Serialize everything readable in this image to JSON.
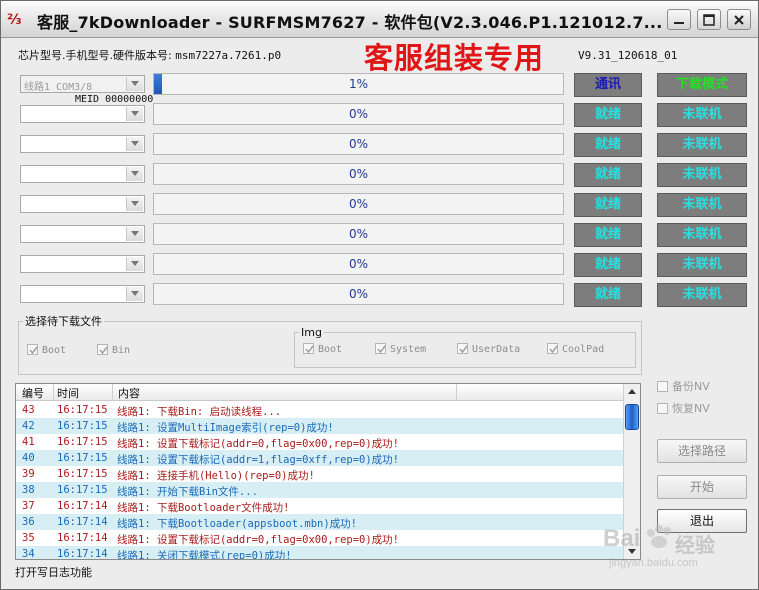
{
  "window": {
    "title": "客服_7kDownloader - SURFMSM7627 - 软件包(V2.3.046.P1.121012.7..."
  },
  "info": {
    "chip_label": "芯片型号.手机型号.硬件版本号:",
    "chip_value": "msm7227a.7261.p0",
    "promo": "客服组装专用",
    "version": "V9.31_120618_01",
    "meid": "MEID 00000000"
  },
  "lines": [
    {
      "port": "线路1  COM3/8",
      "progress_text": "1%",
      "progress": 0.01,
      "status": "通讯",
      "mode": "下载模式"
    },
    {
      "port": "",
      "progress_text": "0%",
      "progress": 0,
      "status": "就绪",
      "mode": "未联机"
    },
    {
      "port": "",
      "progress_text": "0%",
      "progress": 0,
      "status": "就绪",
      "mode": "未联机"
    },
    {
      "port": "",
      "progress_text": "0%",
      "progress": 0,
      "status": "就绪",
      "mode": "未联机"
    },
    {
      "port": "",
      "progress_text": "0%",
      "progress": 0,
      "status": "就绪",
      "mode": "未联机"
    },
    {
      "port": "",
      "progress_text": "0%",
      "progress": 0,
      "status": "就绪",
      "mode": "未联机"
    },
    {
      "port": "",
      "progress_text": "0%",
      "progress": 0,
      "status": "就绪",
      "mode": "未联机"
    },
    {
      "port": "",
      "progress_text": "0%",
      "progress": 0,
      "status": "就绪",
      "mode": "未联机"
    }
  ],
  "files_group": {
    "legend": "选择待下载文件",
    "items": [
      "Boot",
      "Bin"
    ],
    "img_legend": "Img",
    "img_items": [
      "Boot",
      "System",
      "UserData",
      "CoolPad"
    ]
  },
  "log": {
    "headers": [
      "编号",
      "时间",
      "内容"
    ],
    "rows": [
      {
        "no": "43",
        "time": "16:17:15",
        "text": "线路1: 下载Bin: 启动读线程...",
        "color": "red"
      },
      {
        "no": "42",
        "time": "16:17:15",
        "text": "线路1: 设置MultiImage索引(rep=0)成功!",
        "color": "blue"
      },
      {
        "no": "41",
        "time": "16:17:15",
        "text": "线路1: 设置下载标记(addr=0,flag=0x00,rep=0)成功!",
        "color": "red"
      },
      {
        "no": "40",
        "time": "16:17:15",
        "text": "线路1: 设置下载标记(addr=1,flag=0xff,rep=0)成功!",
        "color": "blue"
      },
      {
        "no": "39",
        "time": "16:17:15",
        "text": "线路1: 连接手机(Hello)(rep=0)成功!",
        "color": "red"
      },
      {
        "no": "38",
        "time": "16:17:15",
        "text": "线路1: 开始下载Bin文件...",
        "color": "blue"
      },
      {
        "no": "37",
        "time": "16:17:14",
        "text": "线路1: 下载Bootloader文件成功!",
        "color": "red"
      },
      {
        "no": "36",
        "time": "16:17:14",
        "text": "线路1: 下载Bootloader(appsboot.mbn)成功!",
        "color": "blue"
      },
      {
        "no": "35",
        "time": "16:17:14",
        "text": "线路1: 设置下载标记(addr=0,flag=0x00,rep=0)成功!",
        "color": "red"
      },
      {
        "no": "34",
        "time": "16:17:14",
        "text": "线路1: 关闭下载模式(rep=0)成功!",
        "color": "blue"
      }
    ]
  },
  "side": {
    "backup_nv": "备份NV",
    "restore_nv": "恢复NV",
    "select_path": "选择路径",
    "start": "开始",
    "exit": "退出"
  },
  "status_bar": {
    "text": "打开写日志功能"
  },
  "watermark": {
    "line1": "Bai",
    "line2": "经验",
    "line3": "jingyan.baidu.com"
  },
  "colors": {
    "status_cyan": "#27e0e0",
    "status_active_blue": "#1a1ab8",
    "mode_active_green": "#22e022",
    "promo_red": "#e01515",
    "log_red": "#a81c1c",
    "log_blue": "#1c6ab8",
    "progress_blue": "#1c57b1"
  }
}
